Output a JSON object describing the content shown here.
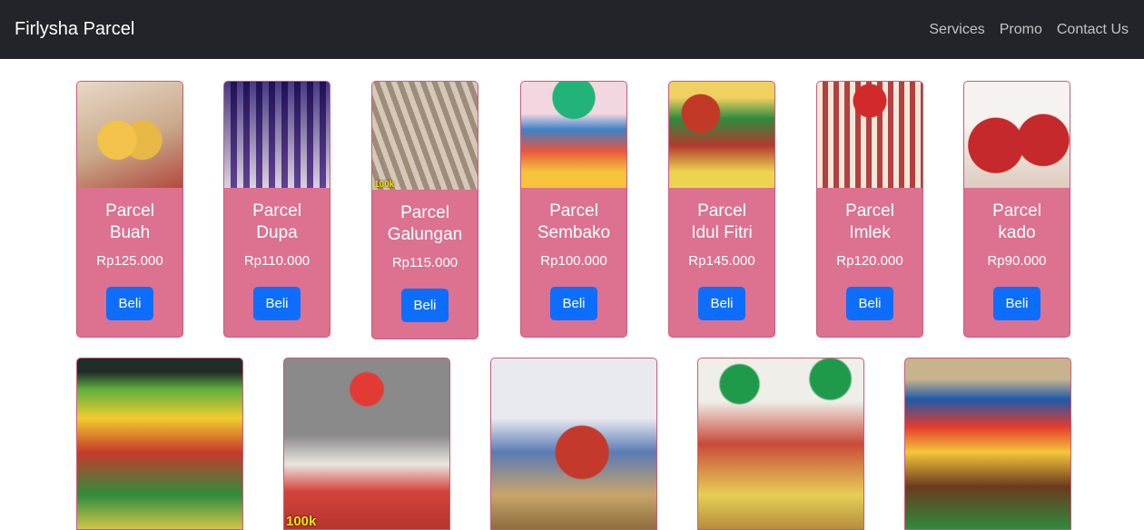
{
  "navbar": {
    "brand": "Firlysha Parcel",
    "links": [
      "Services",
      "Promo",
      "Contact Us"
    ]
  },
  "buy_label": "Beli",
  "products": [
    {
      "name_line1": "Parcel",
      "name_line2": "Buah",
      "price": "Rp125.000"
    },
    {
      "name_line1": "Parcel",
      "name_line2": "Dupa",
      "price": "Rp110.000"
    },
    {
      "name_line1": "Parcel",
      "name_line2": "Galungan",
      "price": "Rp115.000",
      "badge": "100k"
    },
    {
      "name_line1": "Parcel",
      "name_line2": "Sembako",
      "price": "Rp100.000"
    },
    {
      "name_line1": "Parcel",
      "name_line2": "Idul Fitri",
      "price": "Rp145.000"
    },
    {
      "name_line1": "Parcel",
      "name_line2": "Imlek",
      "price": "Rp120.000"
    },
    {
      "name_line1": "Parcel",
      "name_line2": "kado",
      "price": "Rp90.000"
    }
  ],
  "gallery_badge": "100k",
  "colors": {
    "navbar": "#212529",
    "card": "#dc7190",
    "button": "#0d6efd"
  }
}
